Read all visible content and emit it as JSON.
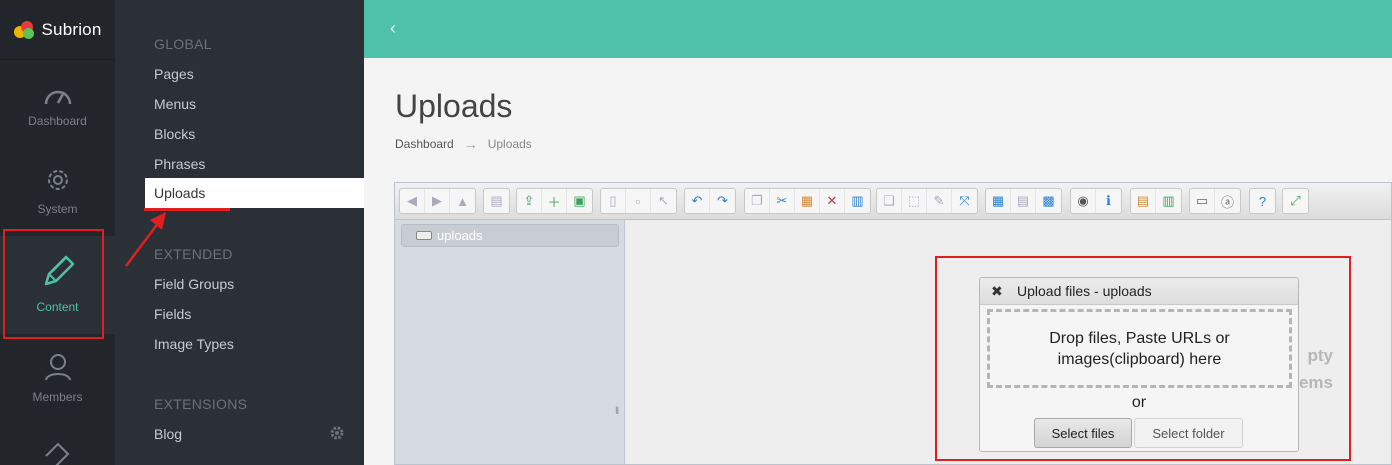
{
  "brand": {
    "name": "Subrion"
  },
  "rail": {
    "items": [
      {
        "label": "Dashboard",
        "icon": "speedometer-icon"
      },
      {
        "label": "System",
        "icon": "gear-icon"
      },
      {
        "label": "Content",
        "icon": "pencil-icon",
        "active": true
      },
      {
        "label": "Members",
        "icon": "user-icon"
      }
    ]
  },
  "subnav": {
    "global_heading": "GLOBAL",
    "global_items": [
      "Pages",
      "Menus",
      "Blocks",
      "Phrases",
      "Uploads"
    ],
    "extended_heading": "EXTENDED",
    "extended_items": [
      "Field Groups",
      "Fields",
      "Image Types"
    ],
    "extensions_heading": "EXTENSIONS",
    "extensions_items": [
      "Blog"
    ]
  },
  "page": {
    "title": "Uploads",
    "breadcrumb": [
      "Dashboard",
      "Uploads"
    ],
    "breadcrumb_sep": "→"
  },
  "file_manager": {
    "tree_root": "uploads",
    "empty_line1": "pty",
    "empty_line2": "ems"
  },
  "upload_dialog": {
    "title": "Upload files - uploads",
    "close": "✖",
    "drop_text": "Drop files, Paste URLs or images(clipboard) here",
    "or": "or",
    "select_files": "Select files",
    "select_folder": "Select folder"
  },
  "colors": {
    "accent": "#4fc1a9",
    "highlight": "#e02020",
    "rail_bg": "#22252a",
    "subnav_bg": "#2b2f36"
  }
}
